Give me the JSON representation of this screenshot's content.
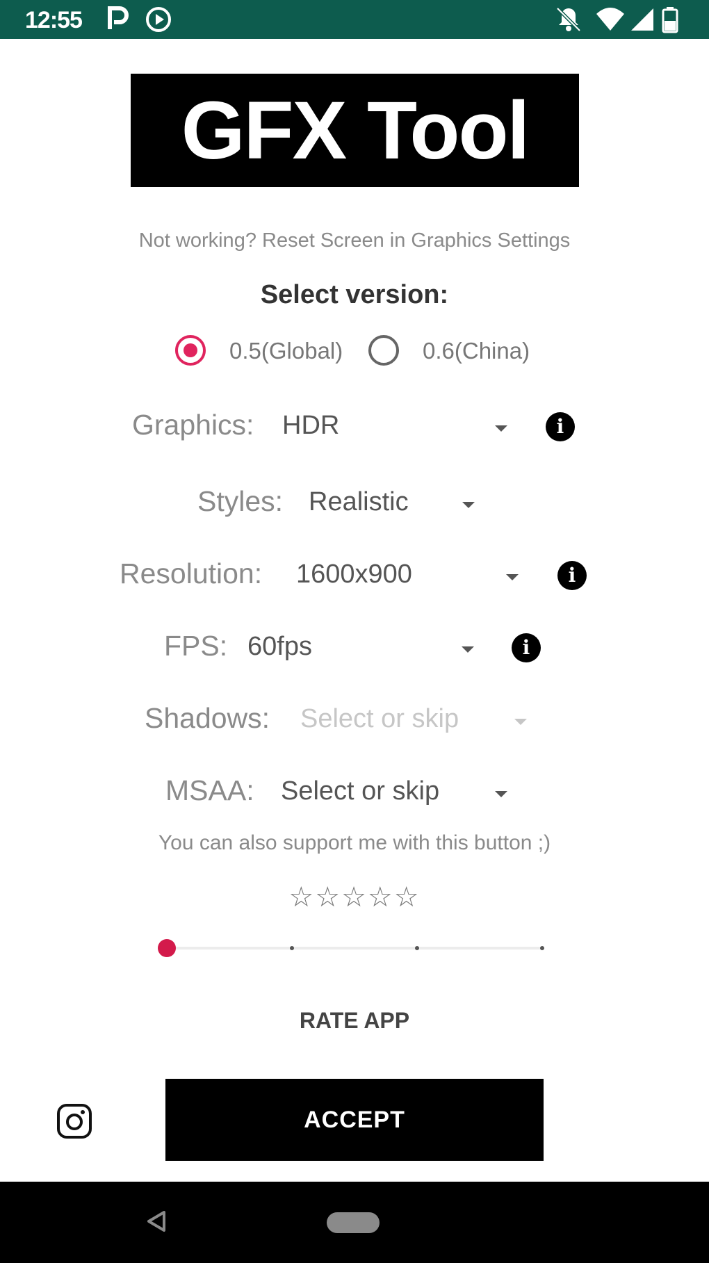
{
  "status_bar": {
    "time": "12:55",
    "left_icons": [
      "parking-p-icon",
      "play-circle-icon"
    ],
    "right_icons": [
      "notifications-off-icon",
      "wifi-icon",
      "signal-icon",
      "battery-icon"
    ],
    "color": "#0d5c4e"
  },
  "header": {
    "logo_text": "GFX Tool"
  },
  "hint": "Not working? Reset Screen in Graphics Settings",
  "version": {
    "title": "Select version:",
    "options": [
      {
        "label": "0.5(Global)",
        "selected": true
      },
      {
        "label": "0.6(China)",
        "selected": false
      }
    ]
  },
  "settings": {
    "graphics": {
      "label": "Graphics:",
      "value": "HDR"
    },
    "styles": {
      "label": "Styles:",
      "value": "Realistic"
    },
    "resolution": {
      "label": "Resolution:",
      "value": "1600x900"
    },
    "fps": {
      "label": "FPS:",
      "value": "60fps"
    },
    "shadows": {
      "label": "Shadows:",
      "value": "Select or skip",
      "disabled": true
    },
    "msaa": {
      "label": "MSAA:",
      "value": "Select or skip"
    }
  },
  "support": {
    "text": "You can also support me with this button ;)",
    "stars": "☆☆☆☆☆",
    "rating_value": 0,
    "rating_max": 5
  },
  "rate_label": "RATE APP",
  "accept_label": "ACCEPT",
  "accent_color": "#e0245e"
}
